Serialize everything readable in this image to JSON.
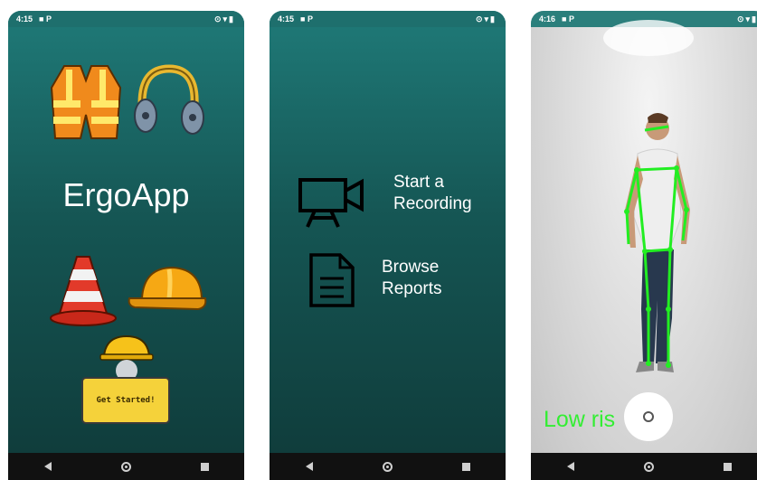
{
  "screens": [
    {
      "status": {
        "time": "4:15",
        "indicators": "P"
      },
      "title": "ErgoApp",
      "button_label": "Get Started!"
    },
    {
      "status": {
        "time": "4:15",
        "indicators": "P"
      },
      "menu": [
        {
          "label": "Start a Recording",
          "icon": "video-camera-icon"
        },
        {
          "label": "Browse Reports",
          "icon": "document-icon"
        }
      ]
    },
    {
      "status": {
        "time": "4:16",
        "indicators": "P"
      },
      "overlay_text": "Low ris"
    }
  ],
  "icons": {
    "status_left": "record-icon",
    "status_right": [
      "location-icon",
      "wifi-icon",
      "battery-icon"
    ],
    "nav": [
      "back-icon",
      "home-icon",
      "recents-icon"
    ]
  },
  "colors": {
    "teal_top": "#1f7a78",
    "teal_bottom": "#0f3a39",
    "skeleton": "#33ee33",
    "button": "#f5d23a"
  }
}
